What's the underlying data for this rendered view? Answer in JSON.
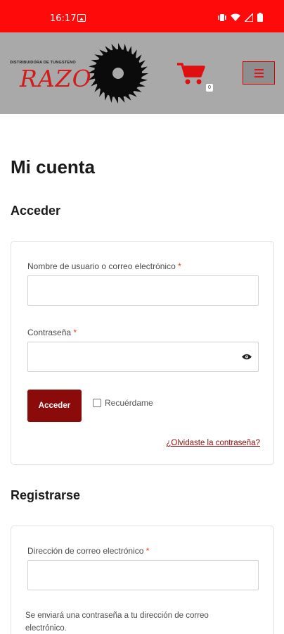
{
  "status_bar": {
    "time": "16:17",
    "icons": [
      "gallery-icon",
      "vibrate-icon",
      "wifi-icon",
      "signal-icon",
      "battery-icon"
    ]
  },
  "header": {
    "logo_subtitle": "DISTRIBUIDORA DE TUNGSTENO",
    "logo_text": "RAZO",
    "cart_count": "0",
    "accent_color": "#ff0a0a",
    "header_bg": "#a9a9a9"
  },
  "page": {
    "title": "Mi cuenta"
  },
  "login": {
    "title": "Acceder",
    "username_label": "Nombre de usuario o correo electrónico",
    "required_mark": "*",
    "username_value": "",
    "password_label": "Contraseña",
    "password_value": "",
    "submit_label": "Acceder",
    "remember_label": "Recuérdame",
    "remember_checked": false,
    "forgot_link": "¿Olvidaste la contraseña?",
    "button_color": "#8b0a0a"
  },
  "register": {
    "title": "Registrarse",
    "email_label": "Dirección de correo electrónico",
    "email_value": "",
    "note": "Se enviará una contraseña a tu dirección de correo electrónico."
  }
}
